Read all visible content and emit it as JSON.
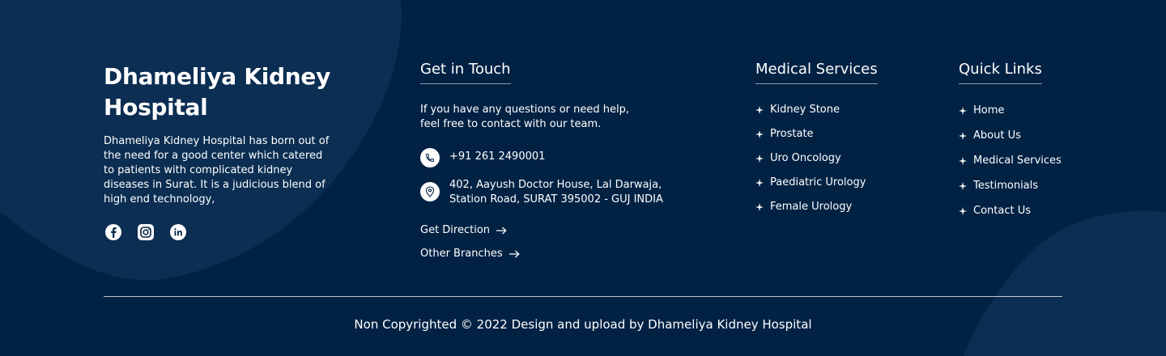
{
  "brand": {
    "name": "Dhameliya Kidney Hospital",
    "description": "Dhameliya Kidney Hospital has born out of the need for a good center which catered to patients with complicated kidney diseases in Surat. It is a judicious blend of high end technology,",
    "socials": [
      {
        "icon": "facebook-icon"
      },
      {
        "icon": "instagram-icon"
      },
      {
        "icon": "linkedin-icon"
      }
    ]
  },
  "contact": {
    "title": "Get in Touch",
    "intro": "If you have any questions or need help, feel free to contact with our team.",
    "phone": "+91 261 2490001",
    "address": "402, Aayush Doctor House, Lal Darwaja, Station Road, SURAT 395002 - GUJ INDIA",
    "get_direction": "Get Direction",
    "other_branches": "Other Branches"
  },
  "services": {
    "title": "Medical Services",
    "items": [
      "Kidney Stone",
      "Prostate",
      "Uro Oncology",
      "Paediatric Urology",
      "Female Urology"
    ]
  },
  "quick_links": {
    "title": "Quick Links",
    "items": [
      "Home",
      "About Us",
      "Medical Services",
      "Testimonials",
      "Contact Us"
    ]
  },
  "footer": {
    "copyright": "Non Copyrighted © 2022 Design and upload by Dhameliya Kidney Hospital"
  },
  "colors": {
    "background": "#022244",
    "blob": "#0b2e52",
    "text": "#ffffff"
  }
}
